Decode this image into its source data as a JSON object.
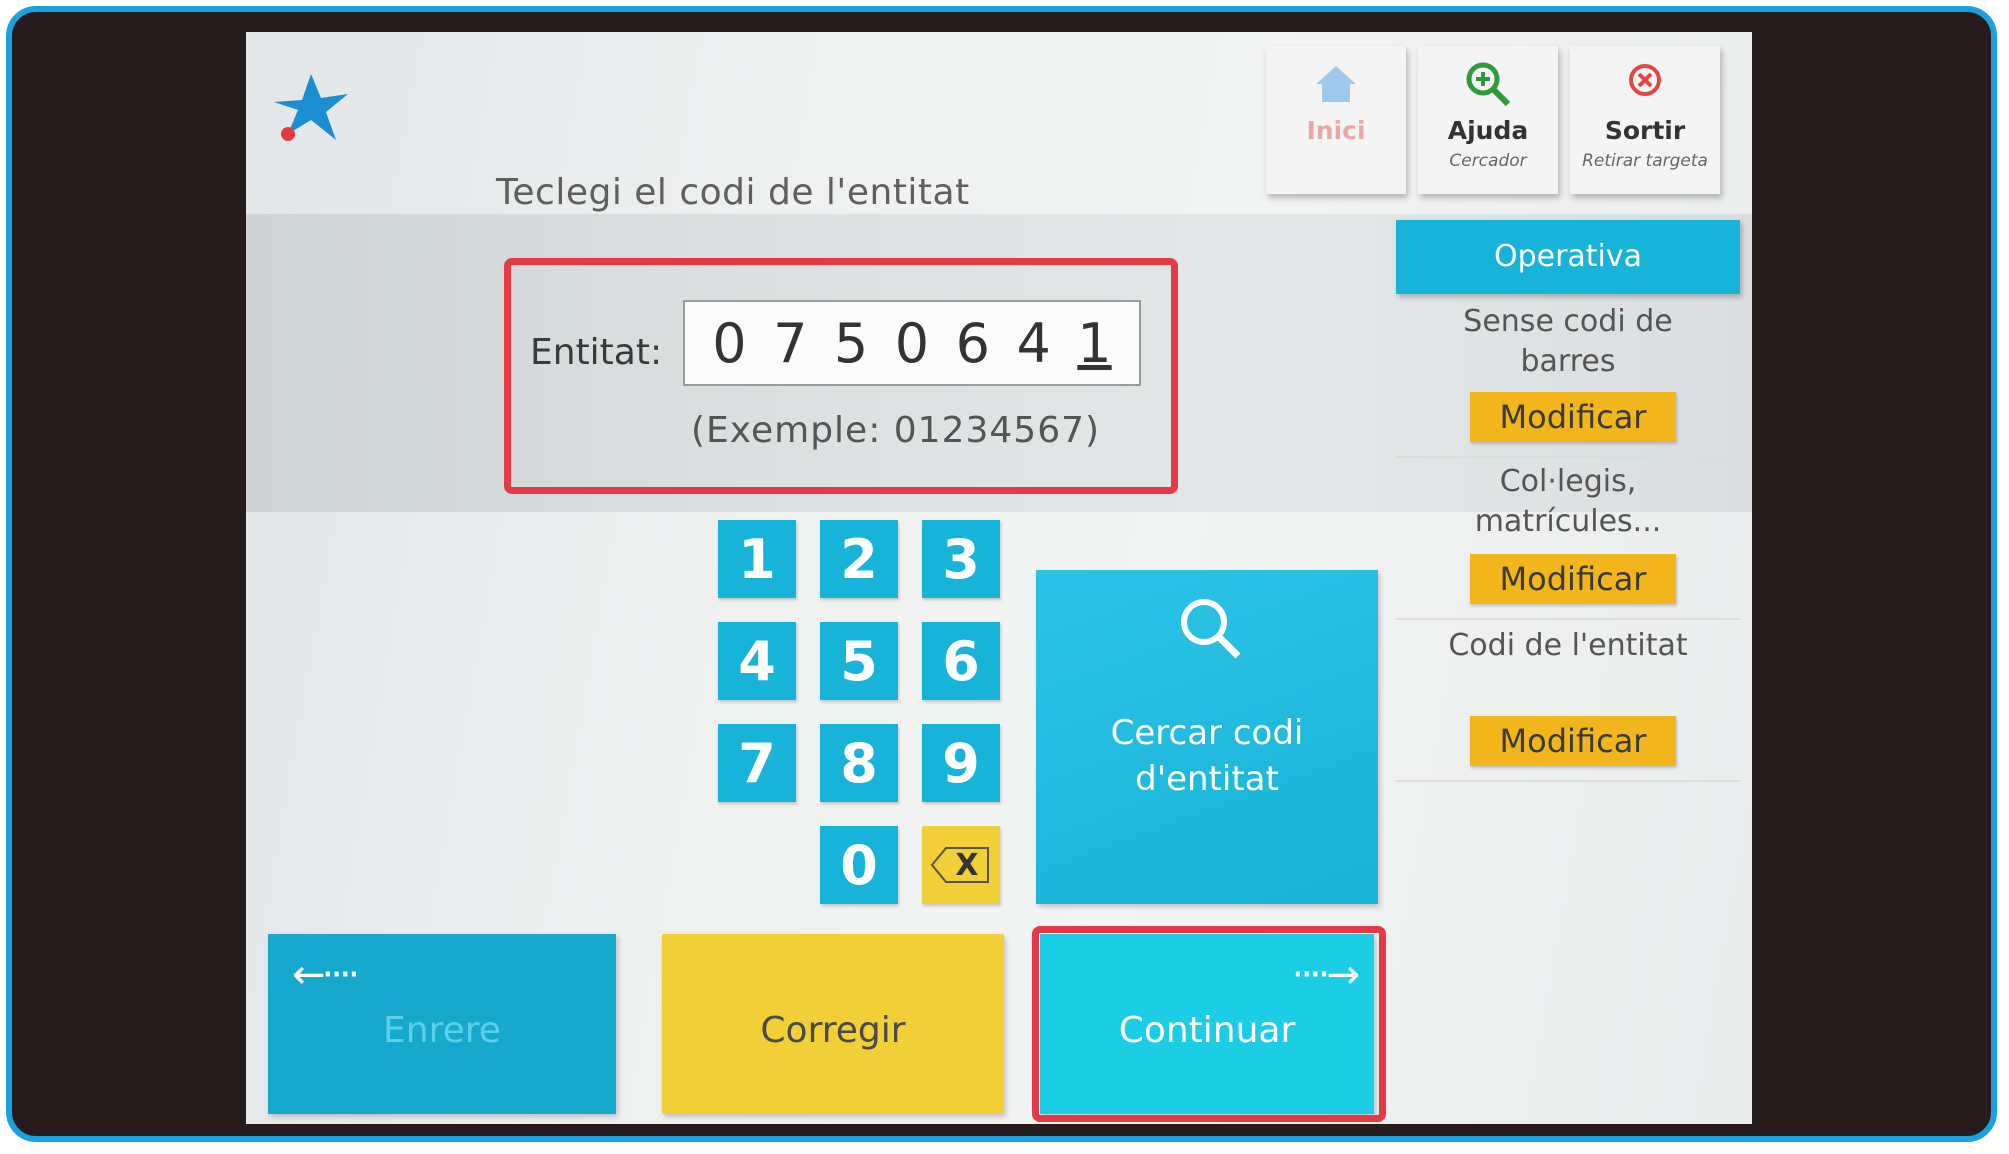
{
  "header": {
    "prompt": "Teclegi el codi de l'entitat",
    "buttons": [
      {
        "label": "Inici",
        "sublabel": "",
        "icon": "home-icon"
      },
      {
        "label": "Ajuda",
        "sublabel": "Cercador",
        "icon": "zoom-in-icon"
      },
      {
        "label": "Sortir",
        "sublabel": "Retirar targeta",
        "icon": "close-circle-icon"
      }
    ]
  },
  "entity": {
    "label": "Entitat:",
    "digits": [
      "0",
      "7",
      "5",
      "0",
      "6",
      "4",
      "1"
    ],
    "example": "(Exemple: 01234567)"
  },
  "keypad": {
    "keys": [
      "1",
      "2",
      "3",
      "4",
      "5",
      "6",
      "7",
      "8",
      "9",
      "0"
    ],
    "delete_label": "X"
  },
  "search": {
    "label": "Cercar codi\nd'entitat",
    "icon": "search-icon"
  },
  "bottom": {
    "back_label": "Enrere",
    "correct_label": "Corregir",
    "continue_label": "Continuar"
  },
  "operativa": {
    "header": "Operativa",
    "items": [
      {
        "label": "Sense codi de barres",
        "button": "Modificar"
      },
      {
        "label": "Col·legis, matrícules...",
        "button": "Modificar"
      },
      {
        "label": "Codi de l'entitat",
        "button": "Modificar"
      }
    ]
  },
  "colors": {
    "accent": "#17b3d9",
    "yellow": "#f1cf36",
    "highlight": "#e63946",
    "frame": "#1aa1e0"
  }
}
